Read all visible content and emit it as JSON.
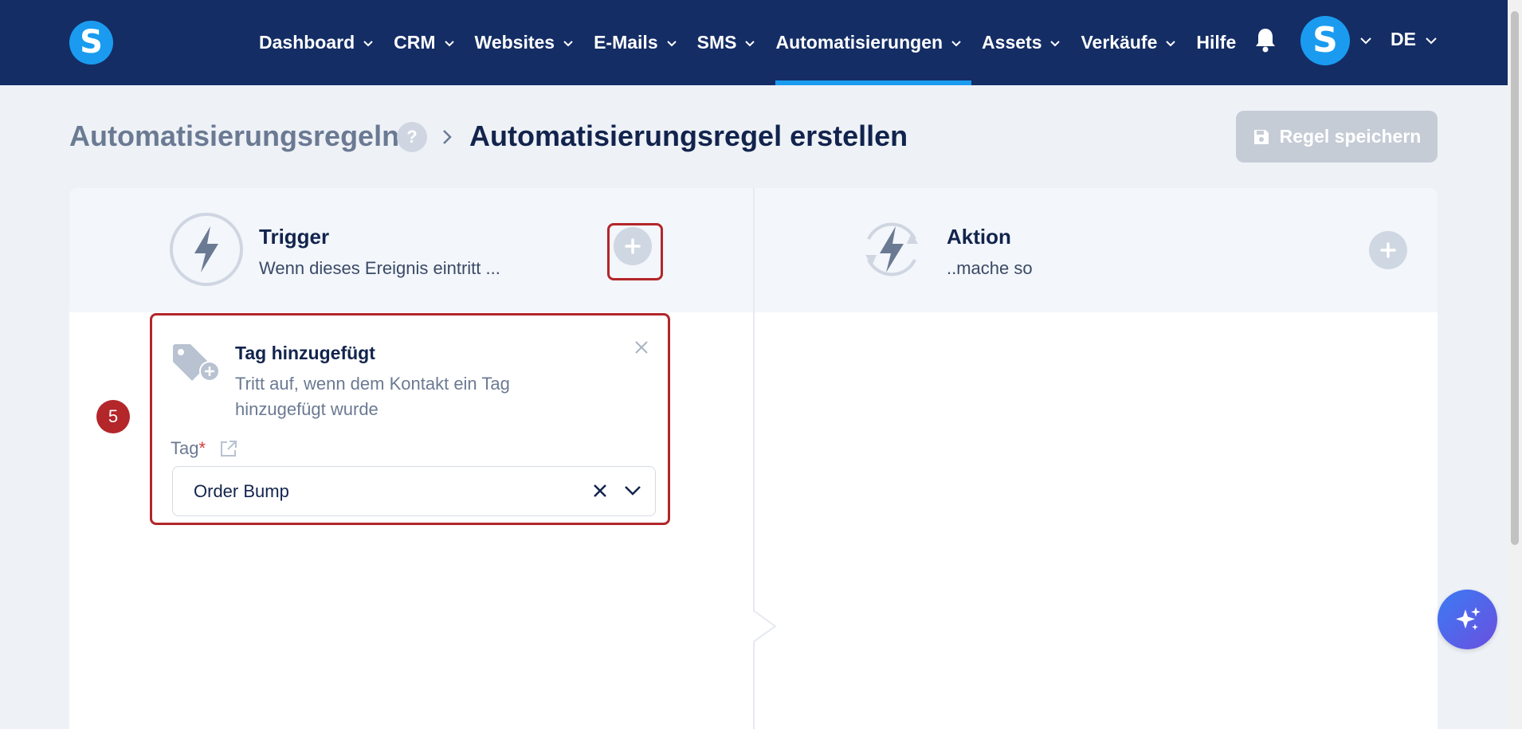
{
  "app": {
    "logo_letter": "S",
    "avatar_letter": "S"
  },
  "nav": {
    "items": [
      {
        "label": "Dashboard",
        "has_dropdown": true
      },
      {
        "label": "CRM",
        "has_dropdown": true
      },
      {
        "label": "Websites",
        "has_dropdown": true
      },
      {
        "label": "E-Mails",
        "has_dropdown": true
      },
      {
        "label": "SMS",
        "has_dropdown": true
      },
      {
        "label": "Automatisierungen",
        "has_dropdown": true,
        "active": true
      },
      {
        "label": "Assets",
        "has_dropdown": true
      },
      {
        "label": "Verkäufe",
        "has_dropdown": true
      },
      {
        "label": "Hilfe",
        "has_dropdown": false
      }
    ],
    "language": "DE"
  },
  "header": {
    "breadcrumb_parent": "Automatisierungsregeln",
    "help_icon": "?",
    "breadcrumb_current": "Automatisierungsregel erstellen",
    "save_label": "Regel speichern"
  },
  "trigger_panel": {
    "title": "Trigger",
    "subtitle": "Wenn dieses Ereignis eintritt ..."
  },
  "action_panel": {
    "title": "Aktion",
    "subtitle": "..mache so"
  },
  "trigger_card": {
    "title": "Tag hinzugefügt",
    "description": "Tritt auf, wenn dem Kontakt ein Tag hinzugefügt wurde",
    "field_label": "Tag",
    "required_mark": "*",
    "selected_value": "Order Bump"
  },
  "annotation": {
    "step_number": "5"
  },
  "colors": {
    "nav_bg": "#142d65",
    "accent": "#1a9bf0",
    "highlight": "#b3262a",
    "text_dark": "#12244d",
    "text_muted": "#6b7a93"
  },
  "icons": {
    "logo": "brand-logo-icon",
    "bell": "bell-icon",
    "trigger": "lightning-icon",
    "action": "lightning-cycle-icon",
    "add": "plus-circle-icon",
    "tag": "tag-add-icon",
    "close": "close-icon",
    "external": "external-link-icon",
    "clear": "clear-icon",
    "dropdown": "chevron-down-icon",
    "ai": "sparkles-icon",
    "save": "floppy-disk-icon"
  }
}
